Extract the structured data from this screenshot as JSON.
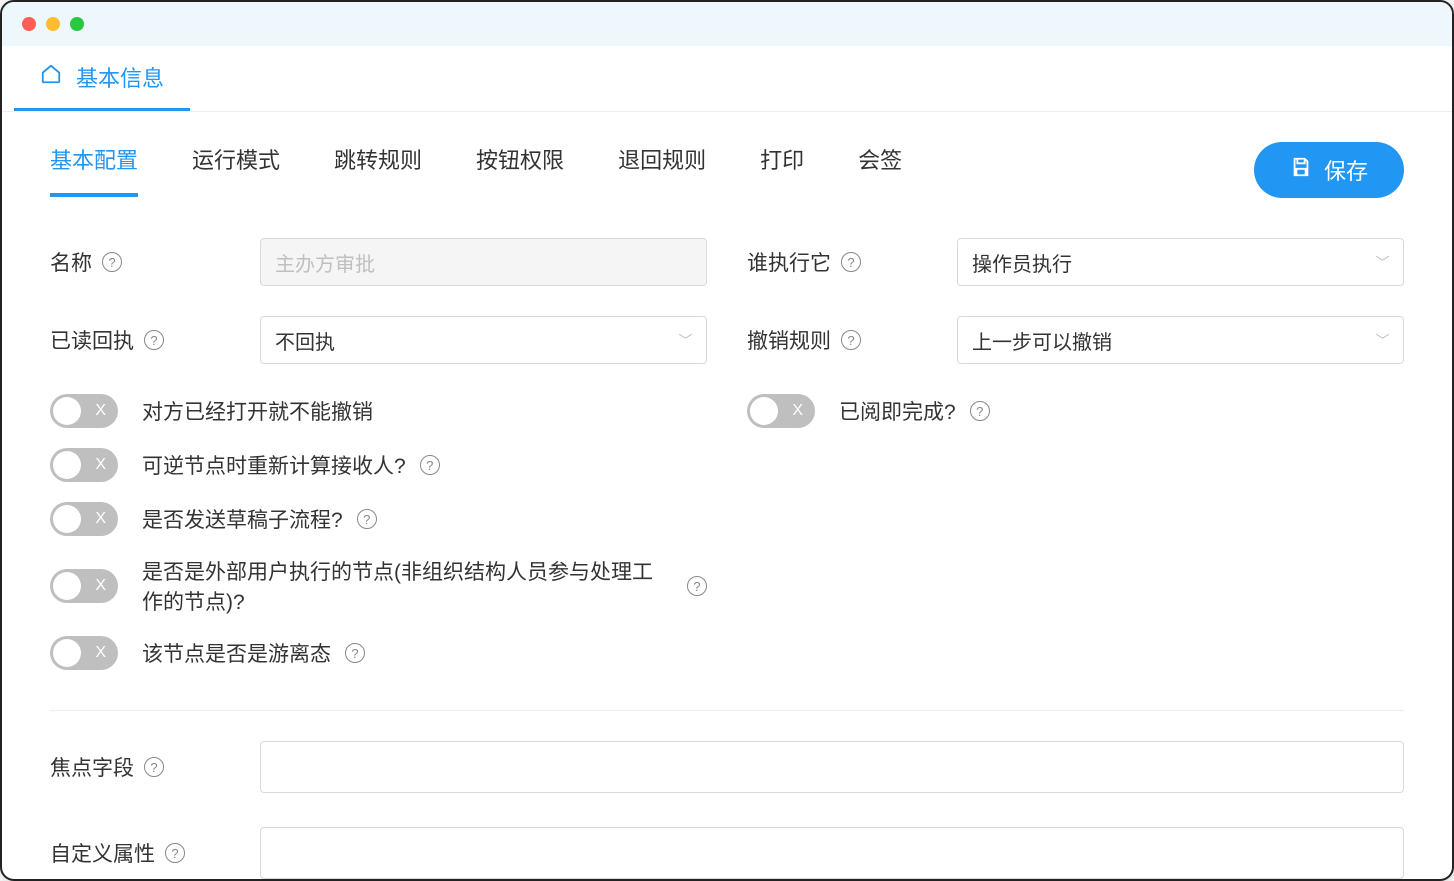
{
  "topTab": {
    "label": "基本信息"
  },
  "subTabs": [
    {
      "label": "基本配置",
      "active": true
    },
    {
      "label": "运行模式",
      "active": false
    },
    {
      "label": "跳转规则",
      "active": false
    },
    {
      "label": "按钮权限",
      "active": false
    },
    {
      "label": "退回规则",
      "active": false
    },
    {
      "label": "打印",
      "active": false
    },
    {
      "label": "会签",
      "active": false
    }
  ],
  "saveButton": {
    "label": "保存"
  },
  "fields": {
    "name": {
      "label": "名称",
      "value": "主办方审批",
      "disabled": true
    },
    "whoExecutes": {
      "label": "谁执行它",
      "value": "操作员执行"
    },
    "readReceipt": {
      "label": "已读回执",
      "value": "不回执"
    },
    "revokeRule": {
      "label": "撤销规则",
      "value": "上一步可以撤销"
    },
    "focusField": {
      "label": "焦点字段",
      "value": ""
    },
    "customAttr": {
      "label": "自定义属性",
      "value": ""
    }
  },
  "toggles": {
    "left": [
      {
        "label": "对方已经打开就不能撤销",
        "help": false
      },
      {
        "label": "可逆节点时重新计算接收人?",
        "help": true
      },
      {
        "label": "是否发送草稿子流程?",
        "help": true
      },
      {
        "label": "是否是外部用户执行的节点(非组织结构人员参与处理工作的节点)?",
        "help": true
      },
      {
        "label": "该节点是否是游离态",
        "help": true
      }
    ],
    "right": [
      {
        "label": "已阅即完成?",
        "help": true
      }
    ]
  },
  "toggleOffMark": "X"
}
